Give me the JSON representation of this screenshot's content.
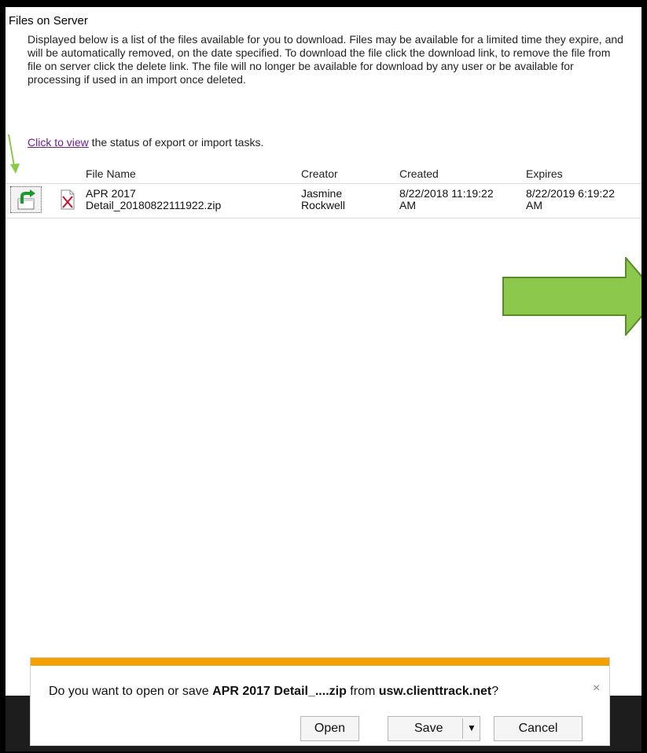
{
  "page": {
    "title": "Files on Server",
    "description": "Displayed below is a list of the files available for you to download. Files may be available for a limited time they expire, and will be automatically removed, on the date specified. To download the file click the download link, to remove the file from file on server click the delete link. The file will no longer be available for download by any user or be available for processing if used in an import once deleted.",
    "view_link": "Click to view",
    "view_suffix": " the status of export or import tasks."
  },
  "table": {
    "headers": [
      "File Name",
      "Creator",
      "Created",
      "Expires"
    ],
    "rows": [
      {
        "file_name_line1": "APR 2017",
        "file_name_line2": "Detail_20180822111922.zip",
        "creator_line1": "Jasmine",
        "creator_line2": "Rockwell",
        "created_line1": "8/22/2018 11:19:22",
        "created_line2": "AM",
        "expires_line1": "8/22/2019 6:19:22",
        "expires_line2": "AM"
      }
    ]
  },
  "download_bar": {
    "prefix": "Do you want to open or save ",
    "filename": "APR 2017 Detail_....zip",
    "middle": " from ",
    "host": "usw.clienttrack.net",
    "suffix": "?",
    "close": "×",
    "open_label": "Open",
    "save_label": "Save",
    "save_dropdown": "▼",
    "cancel_label": "Cancel"
  },
  "colors": {
    "accent_bar": "#f2a100",
    "annotation_arrow": "#8cc84b",
    "link": "#6b1f8f"
  },
  "icons": [
    "download-icon",
    "zip-file-icon",
    "annotation-arrow-icon"
  ]
}
